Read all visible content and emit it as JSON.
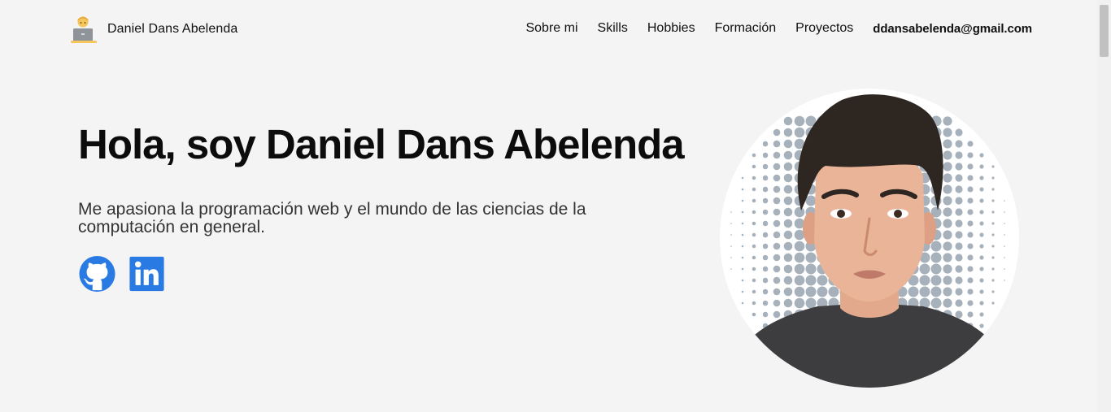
{
  "nav": {
    "brand_name": "Daniel Dans Abelenda",
    "brand_icon": "developer-laptop-emoji-icon",
    "links": [
      "Sobre mi",
      "Skills",
      "Hobbies",
      "Formación",
      "Proyectos"
    ],
    "email": "ddansabelenda@gmail.com"
  },
  "hero": {
    "title": "Hola, soy Daniel Dans Abelenda",
    "subtitle": "Me apasiona la programación web y el mundo de las ciencias de la computación en general.",
    "socials": [
      {
        "icon": "github-icon",
        "color": "#2a7ae4"
      },
      {
        "icon": "linkedin-icon",
        "color": "#2a7ae4"
      }
    ]
  },
  "colors": {
    "background": "#f4f4f4",
    "accent": "#2a7ae4",
    "text": "#111111"
  }
}
